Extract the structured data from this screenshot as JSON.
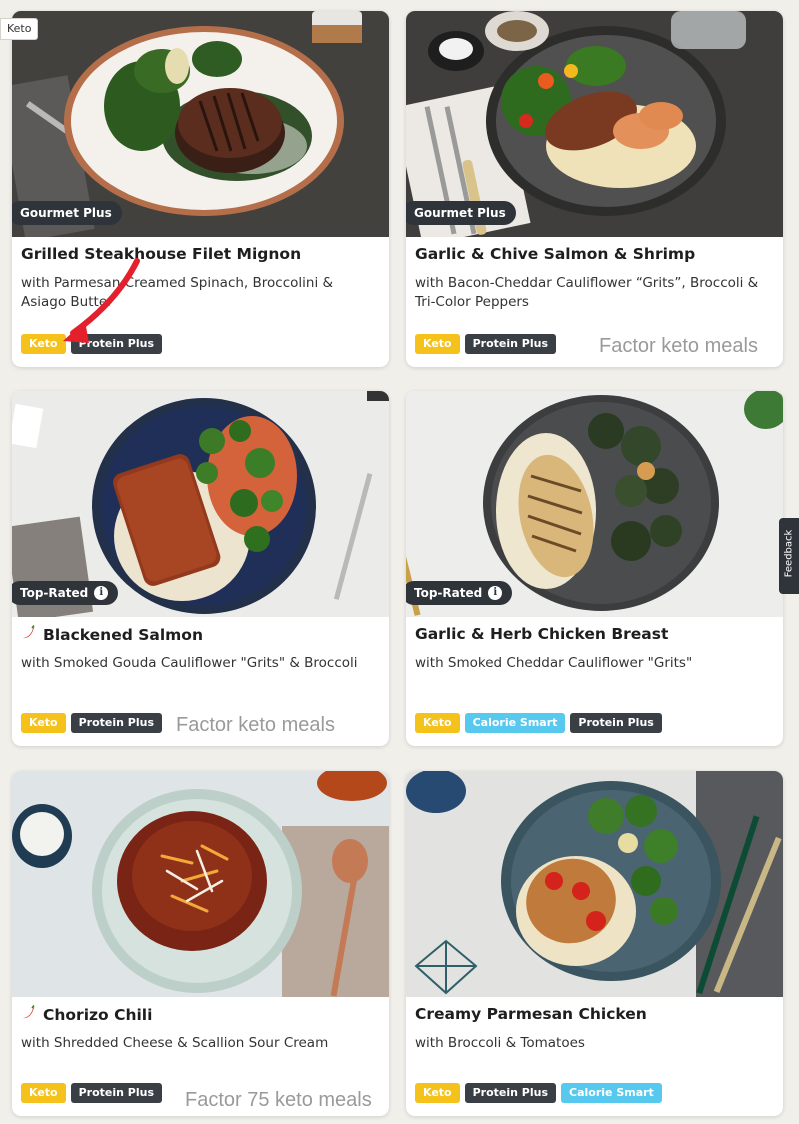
{
  "top_tag": "Keto",
  "feedback_label": "Feedback",
  "meals": [
    {
      "badge": "Gourmet Plus",
      "title": "Grilled Steakhouse Filet Mignon",
      "subtitle": "with Parmesan Creamed Spinach, Broccolini & Asiago Butter",
      "tags": [
        "Keto",
        "Protein Plus"
      ],
      "watermark": "Factor keto meals"
    },
    {
      "badge": "Gourmet Plus",
      "title": "Garlic & Chive Salmon & Shrimp",
      "subtitle": "with Bacon-Cheddar Cauliflower “Grits”, Broccoli & Tri-Color Peppers",
      "tags": [
        "Keto",
        "Protein Plus"
      ],
      "watermark": "Factor keto meals"
    },
    {
      "badge": "Top-Rated",
      "title": "Blackened Salmon",
      "subtitle": "with Smoked Gouda Cauliflower \"Grits\" & Broccoli",
      "tags": [
        "Keto",
        "Protein Plus"
      ],
      "watermark": "Factor keto meals",
      "spicy": true
    },
    {
      "badge": "Top-Rated",
      "title": "Garlic & Herb Chicken Breast",
      "subtitle": "with Smoked Cheddar Cauliflower \"Grits\"",
      "tags": [
        "Keto",
        "Calorie Smart",
        "Protein Plus"
      ]
    },
    {
      "title": "Chorizo Chili",
      "subtitle": "with Shredded Cheese & Scallion Sour Cream",
      "tags": [
        "Keto",
        "Protein Plus"
      ],
      "watermark": "Factor 75 keto meals",
      "spicy": true
    },
    {
      "title": "Creamy Parmesan Chicken",
      "subtitle": "with Broccoli & Tomatoes",
      "tags": [
        "Keto",
        "Protein Plus",
        "Calorie Smart"
      ]
    }
  ],
  "colors": {
    "keto_tag": "#f5c11b",
    "protein_plus_tag": "#3a3f46",
    "calorie_smart_tag": "#57c9ee",
    "badge": "#2f333a",
    "annotation_arrow": "#e3202c"
  },
  "icons": {
    "spicy": "chili-pepper-icon",
    "info": "info-icon",
    "annotation": "red-arrow-annotation"
  }
}
